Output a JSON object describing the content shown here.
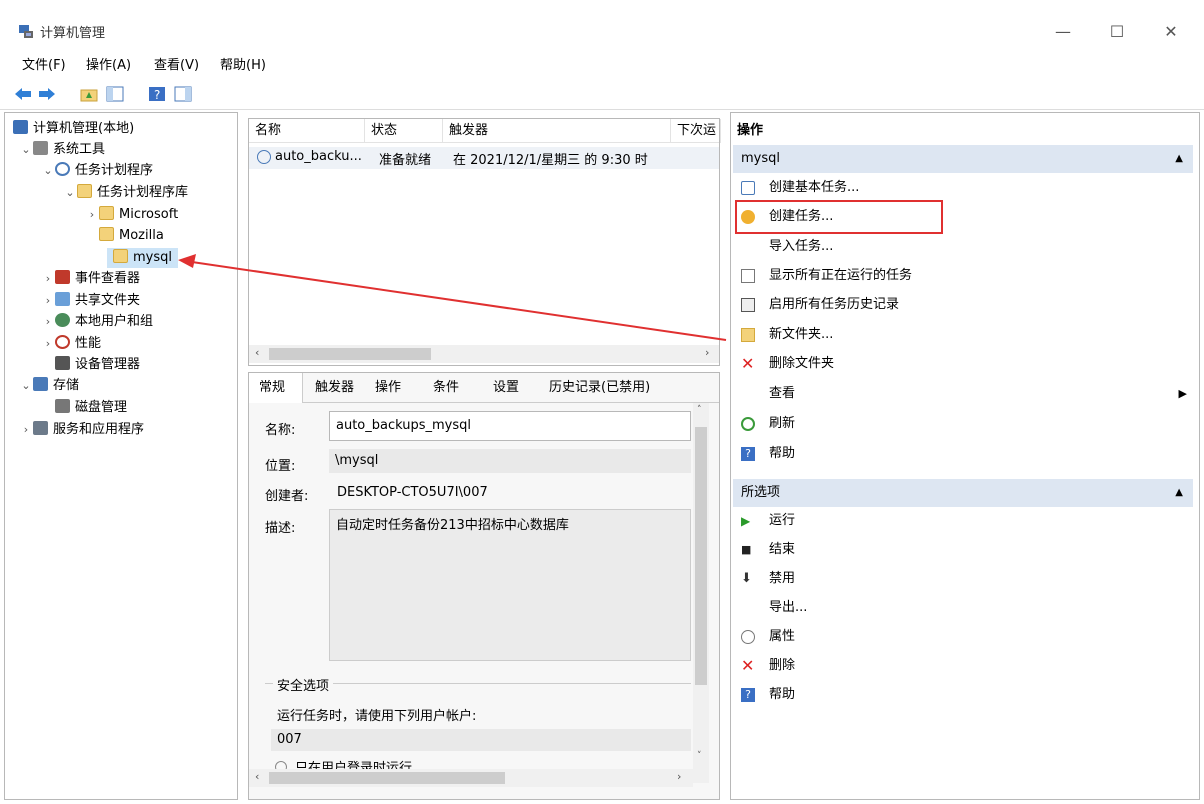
{
  "window": {
    "title": "计算机管理",
    "min": "—",
    "max": "☐",
    "close": "✕"
  },
  "menu": [
    "文件(F)",
    "操作(A)",
    "查看(V)",
    "帮助(H)"
  ],
  "tree": {
    "root": "计算机管理(本地)",
    "system_tools": "系统工具",
    "task_scheduler": "任务计划程序",
    "task_library": "任务计划程序库",
    "microsoft": "Microsoft",
    "mozilla": "Mozilla",
    "mysql": "mysql",
    "event_viewer": "事件查看器",
    "shared_folders": "共享文件夹",
    "local_users": "本地用户和组",
    "performance": "性能",
    "device_manager": "设备管理器",
    "storage": "存储",
    "disk_mgmt": "磁盘管理",
    "services_apps": "服务和应用程序"
  },
  "task_list": {
    "columns": [
      "名称",
      "状态",
      "触发器",
      "下次运"
    ],
    "rows": [
      {
        "name": "auto_backu...",
        "status": "准备就绪",
        "trigger": "在 2021/12/1/星期三 的 9:30 时"
      }
    ]
  },
  "tabs": [
    "常规",
    "触发器",
    "操作",
    "条件",
    "设置",
    "历史记录(已禁用)"
  ],
  "general": {
    "name_label": "名称:",
    "name_value": "auto_backups_mysql",
    "location_label": "位置:",
    "location_value": "\\mysql",
    "author_label": "创建者:",
    "author_value": "DESKTOP-CTO5U7I\\007",
    "desc_label": "描述:",
    "desc_value": "自动定时任务备份213中招标中心数据库",
    "security_title": "安全选项",
    "run_as_label": "运行任务时，请使用下列用户帐户:",
    "run_as_value": "007",
    "radio_text": "只在用户登录时运行"
  },
  "actions": {
    "header": "操作",
    "section1": "mysql",
    "items1": [
      "创建基本任务...",
      "创建任务...",
      "导入任务...",
      "显示所有正在运行的任务",
      "启用所有任务历史记录",
      "新文件夹...",
      "删除文件夹",
      "查看",
      "刷新",
      "帮助"
    ],
    "section2": "所选项",
    "items2": [
      "运行",
      "结束",
      "禁用",
      "导出...",
      "属性",
      "删除",
      "帮助"
    ]
  },
  "colors": {
    "highlight_box": "#e03030",
    "arrow": "#e03030",
    "section_bg": "#dde6f2"
  }
}
